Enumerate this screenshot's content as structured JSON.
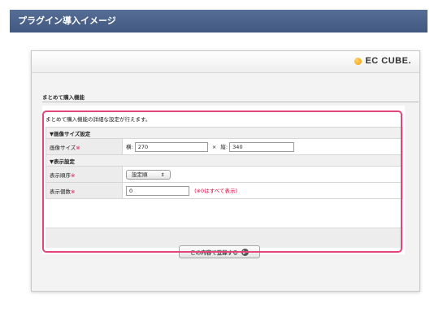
{
  "header": {
    "title": "プラグイン導入イメージ"
  },
  "brand": {
    "logo_text": "EC CUBE.",
    "accent": "#f29a00"
  },
  "section": {
    "title": "まとめて購入機能"
  },
  "description": "まとめて購入機能の詳細な設定が行えます。",
  "groups": {
    "image_size": {
      "label": "▼画像サイズ設定",
      "field_label": "画像サイズ",
      "width_label": "横:",
      "width_value": "270",
      "separator": "×",
      "height_label": "縦:",
      "height_value": "340"
    },
    "display": {
      "label": "▼表示設定",
      "order_label": "表示順序",
      "order_value": "設定順",
      "order_arrow": "⇕",
      "count_label": "表示個数",
      "count_value": "0",
      "count_note": "(※0はすべて表示)"
    }
  },
  "required_mark": "※",
  "save_button": {
    "label": "この内容で登録する",
    "icon": "arrow-right-icon"
  },
  "colors": {
    "header_bg": "#4c658c",
    "highlight": "#e2457a",
    "required": "#e0003f"
  }
}
